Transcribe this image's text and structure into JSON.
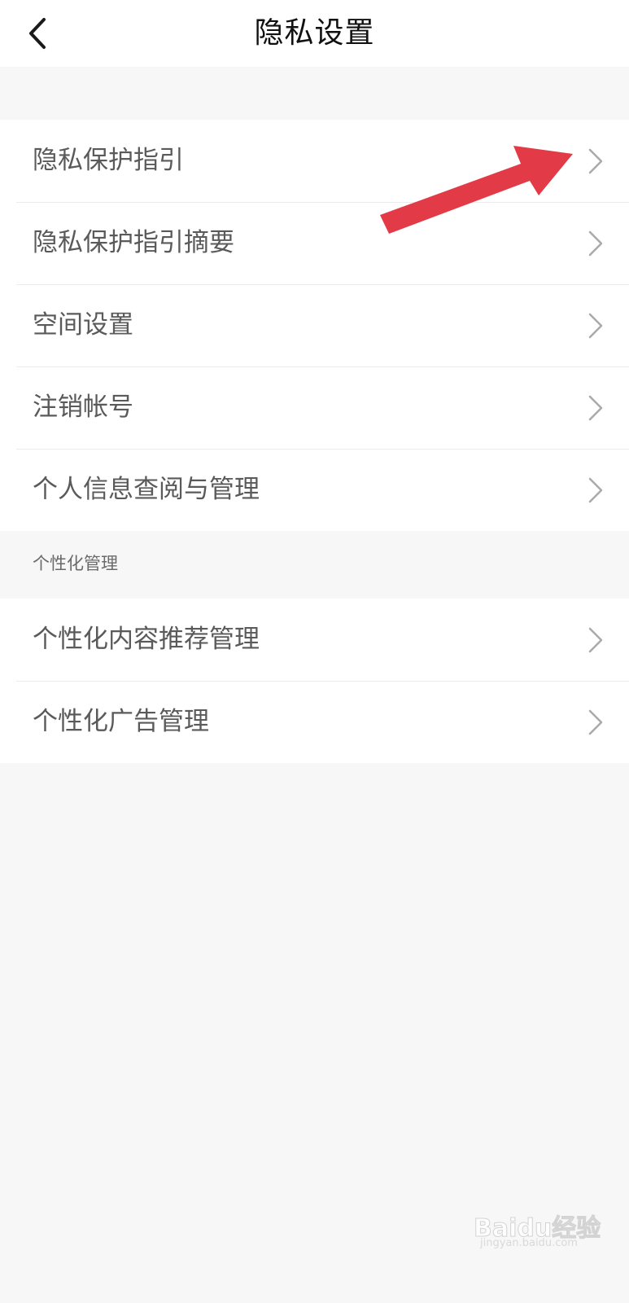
{
  "header": {
    "title": "隐私设置",
    "back_icon": "chevron-left-icon"
  },
  "menu": {
    "items": [
      {
        "label": "隐私保护指引"
      },
      {
        "label": "隐私保护指引摘要"
      },
      {
        "label": "空间设置"
      },
      {
        "label": "注销帐号"
      },
      {
        "label": "个人信息查阅与管理"
      }
    ]
  },
  "personalization": {
    "section_label": "个性化管理",
    "items": [
      {
        "label": "个性化内容推荐管理"
      },
      {
        "label": "个性化广告管理"
      }
    ]
  },
  "annotation": {
    "arrow_color": "#e23a46",
    "arrow_icon": "red-arrow-icon"
  },
  "watermark": {
    "text": "Baidu经验",
    "sub": "jingyan.baidu.com"
  },
  "colors": {
    "background": "#f7f7f7",
    "surface": "#ffffff",
    "text_primary": "#111111",
    "text_secondary": "#5a5a5a",
    "chevron": "#aaaaaa"
  }
}
